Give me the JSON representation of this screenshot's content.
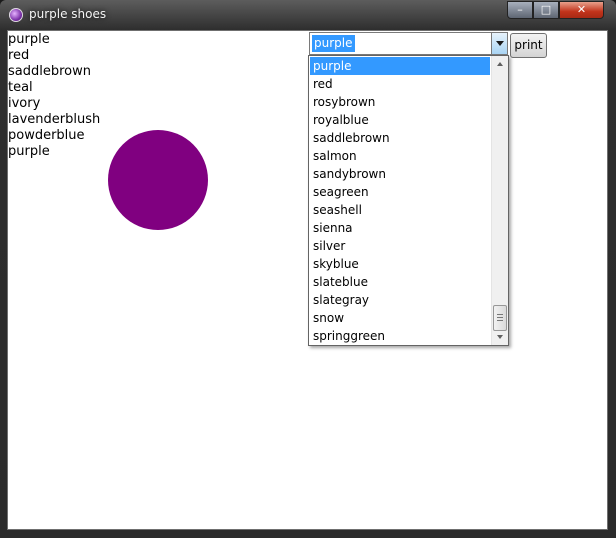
{
  "window": {
    "title": "purple shoes",
    "minimize_label": "–",
    "maximize_label": "□",
    "close_label": "✕",
    "icon": "app-icon"
  },
  "color_list": [
    "purple",
    "red",
    "saddlebrown",
    "teal",
    "ivory",
    "lavenderblush",
    "powderblue",
    "purple"
  ],
  "circle": {
    "fill": "#800080"
  },
  "combo": {
    "selected": "purple",
    "selection_color": "#3399ff"
  },
  "print_button": {
    "label": "print"
  },
  "dropdown": {
    "items": [
      "purple",
      "red",
      "rosybrown",
      "royalblue",
      "saddlebrown",
      "salmon",
      "sandybrown",
      "seagreen",
      "seashell",
      "sienna",
      "silver",
      "skyblue",
      "slateblue",
      "slategray",
      "snow",
      "springgreen"
    ],
    "highlighted_index": 0,
    "highlight_color": "#3399ff"
  }
}
